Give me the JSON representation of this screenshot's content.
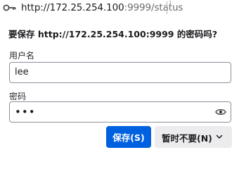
{
  "urlbar": {
    "host": "http://172.25.254.100",
    "rest": ":9999/status",
    "tail_glyph": "1"
  },
  "prompt": {
    "title": "要保存 http://172.25.254.100:9999 的密码吗?",
    "username_label": "用户名",
    "username_value": "lee",
    "password_label": "密码",
    "password_mask": "•••",
    "save_label": "保存(S)",
    "never_label": "暂时不要(N)"
  },
  "colors": {
    "accent": "#0061e0",
    "secondary_button": "#ececef"
  },
  "icons": {
    "urlbar": "key-icon",
    "password_field": "eye-icon",
    "dropdown": "chevron-down-icon"
  }
}
